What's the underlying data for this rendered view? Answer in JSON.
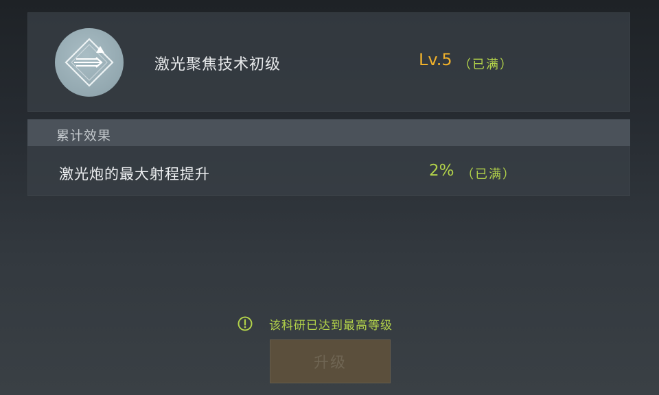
{
  "tech": {
    "icon": "laser-focus-icon",
    "name": "激光聚焦技术初级",
    "level": "Lv.5",
    "status": "（已满）"
  },
  "effects": {
    "header": "累计效果",
    "row": {
      "label": "激光炮的最大射程提升",
      "value": "2%",
      "status": "（已满）"
    }
  },
  "notice": {
    "icon": "exclamation-circle-icon",
    "text": "该科研已达到最高等级"
  },
  "upgrade_button": {
    "label": "升级"
  },
  "colors": {
    "level": "#f0b12b",
    "maxed": "#b3d34a",
    "button_disabled_bg": "#5b4f3c",
    "button_disabled_text": "#6f6553"
  }
}
